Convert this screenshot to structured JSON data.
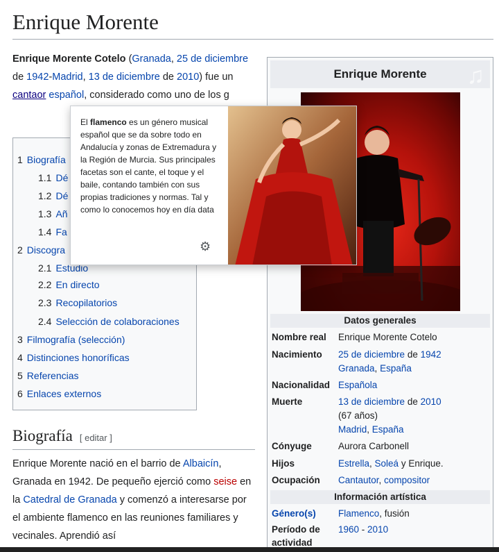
{
  "title": "Enrique Morente",
  "lead": {
    "bold_name": "Enrique Morente Cotelo",
    "t1": " (",
    "l_granada": "Granada",
    "t2": ", ",
    "l_25dic": "25 de diciembre",
    "t3": " de ",
    "l_1942": "1942",
    "t4": "-",
    "l_madrid": "Madrid",
    "t5": ", ",
    "l_13dic": "13 de diciembre",
    "t6": " de ",
    "l_2010": "2010",
    "t7": ") fue un ",
    "l_cantaor": "cantaor",
    "t8": " ",
    "l_espanol": "español",
    "t9": ", considerado como uno de los g"
  },
  "toc": {
    "items": [
      {
        "num": "1",
        "label": "Biografía"
      },
      {
        "num": "1.1",
        "label": "Dé"
      },
      {
        "num": "1.2",
        "label": "Dé"
      },
      {
        "num": "1.3",
        "label": "Añ"
      },
      {
        "num": "1.4",
        "label": "Fa"
      },
      {
        "num": "2",
        "label": "Discogra"
      },
      {
        "num": "2.1",
        "label": "Estudio"
      },
      {
        "num": "2.2",
        "label": "En directo"
      },
      {
        "num": "2.3",
        "label": "Recopilatorios"
      },
      {
        "num": "2.4",
        "label": "Selección de colaboraciones"
      },
      {
        "num": "3",
        "label": "Filmografía (selección)"
      },
      {
        "num": "4",
        "label": "Distinciones honoríficas"
      },
      {
        "num": "5",
        "label": "Referencias"
      },
      {
        "num": "6",
        "label": "Enlaces externos"
      }
    ]
  },
  "bio": {
    "heading": "Biografía",
    "edit": "[ editar ]",
    "t1": "Enrique Morente nació en el barrio de ",
    "l_albaicin": "Albaicín",
    "t2": ", Granada en 1942. De pequeño ejerció como ",
    "l_seise": "seise",
    "t3": " en la ",
    "l_catedral": "Catedral de Granada",
    "t4": " y comenzó a interesarse por el ambiente flamenco en las reuniones familiares y vecinales. Aprendió así"
  },
  "infobox": {
    "title": "Enrique Morente",
    "section_general": "Datos generales",
    "section_art": "Información artística",
    "nombre_label": "Nombre real",
    "nombre_value": "Enrique Morente Cotelo",
    "nac_label": "Nacimiento",
    "nac_date": "25 de diciembre",
    "nac_de": " de ",
    "nac_year": "1942",
    "nac_city": "Granada",
    "nac_comma": ", ",
    "nac_country": "España",
    "nacio_label": "Nacionalidad",
    "nacio_value": "Española",
    "muerte_label": "Muerte",
    "muerte_date": "13 de diciembre",
    "muerte_de": " de ",
    "muerte_year": "2010",
    "muerte_age": "(67 años)",
    "muerte_city": "Madrid",
    "muerte_comma": ", ",
    "muerte_country": "España",
    "conyuge_label": "Cónyuge",
    "conyuge_value": "Aurora Carbonell",
    "hijos_label": "Hijos",
    "hijo1": "Estrella",
    "hijos_sep": ", ",
    "hijo2": "Soleá",
    "hijos_rest": " y Enrique.",
    "ocup_label": "Ocupación",
    "ocup1": "Cantautor",
    "ocup_sep": ", ",
    "ocup2": "compositor",
    "genero_label": "Género(s)",
    "genero_link": "Flamenco",
    "genero_rest": ", fusión",
    "periodo_label": "Período de actividad",
    "periodo_start": "1960",
    "periodo_sep": " - ",
    "periodo_end": "2010"
  },
  "popup": {
    "t1": "El ",
    "bold": "flamenco",
    "t2": " es un género musical español que se da sobre todo en Andalucía y zonas de Extremadura y la Región de Murcia. Sus principales facetas son el cante, el toque y el baile, contando también con sus propias tradiciones y normas. Tal y como lo conocemos hoy en día data"
  },
  "icons": {
    "gear": "gear-icon",
    "music_note": "music-note-icon"
  },
  "colors": {
    "link": "#0645ad",
    "redlink": "#ba0000",
    "infobox_bg": "#f8f9fa",
    "header_bg": "#eaecf0"
  }
}
